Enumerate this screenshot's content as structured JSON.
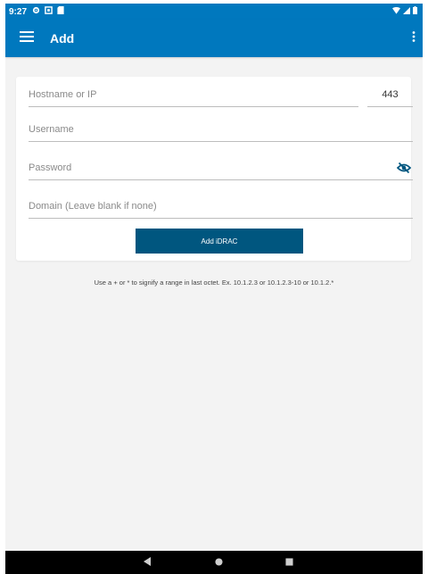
{
  "status_bar": {
    "time": "9:27",
    "icons": [
      "gear-icon",
      "notification-icon",
      "sd-card-icon"
    ],
    "right_icons": [
      "wifi-icon",
      "signal-icon",
      "battery-icon"
    ]
  },
  "app_bar": {
    "title": "Add",
    "background": "#0078be"
  },
  "form": {
    "hostname": {
      "placeholder": "Hostname or IP",
      "value": ""
    },
    "port": {
      "placeholder": "",
      "value": "443"
    },
    "username": {
      "placeholder": "Username",
      "value": ""
    },
    "password": {
      "placeholder": "Password",
      "value": ""
    },
    "domain": {
      "placeholder": "Domain (Leave blank if none)",
      "value": ""
    },
    "submit_label": "Add iDRAC",
    "submit_color": "#00567f"
  },
  "hint": "Use a + or * to signify a range in last octet. Ex. 10.1.2.3 or 10.1.2.3-10 or 10.1.2.*",
  "nav_bar": [
    "back-icon",
    "home-icon",
    "recents-icon"
  ]
}
